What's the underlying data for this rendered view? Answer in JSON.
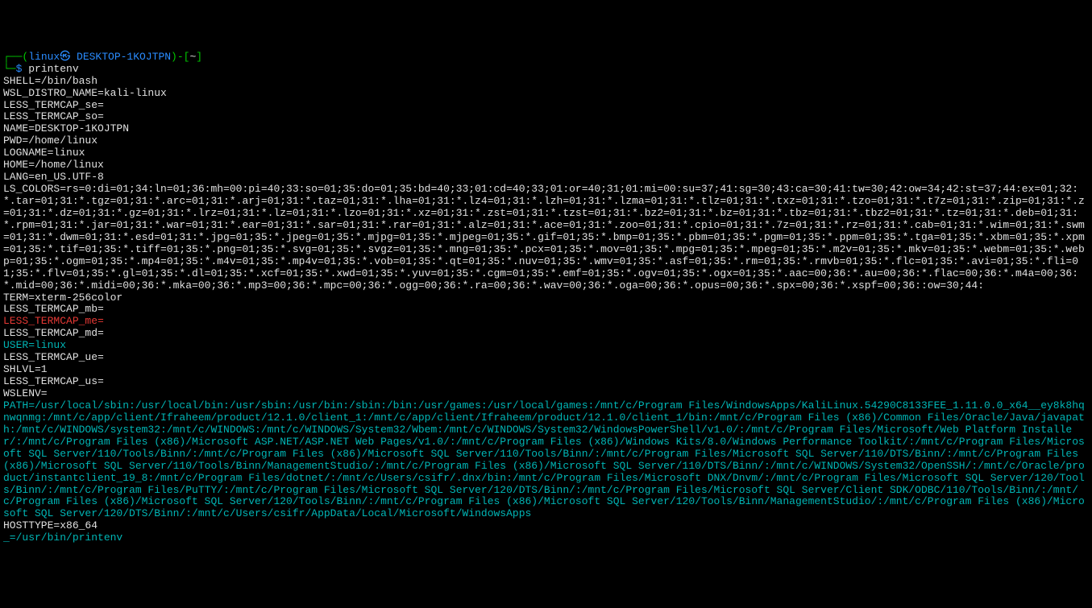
{
  "prompt": {
    "open": "┌──(",
    "user_host": "linux㉿ DESKTOP-1KOJTPN",
    "close_path_open": ")-[",
    "path": "~",
    "path_close": "]",
    "line2_prefix": "└─",
    "dollar": "$ ",
    "command": "printenv"
  },
  "env": {
    "SHELL": "SHELL=/bin/bash",
    "WSL_DISTRO_NAME": "WSL_DISTRO_NAME=kali-linux",
    "LESS_TERMCAP_se": "LESS_TERMCAP_se=",
    "LESS_TERMCAP_so": "LESS_TERMCAP_so=",
    "NAME": "NAME=DESKTOP-1KOJTPN",
    "PWD": "PWD=/home/linux",
    "LOGNAME": "LOGNAME=linux",
    "HOME": "HOME=/home/linux",
    "LANG": "LANG=en_US.UTF-8",
    "LS_COLORS": "LS_COLORS=rs=0:di=01;34:ln=01;36:mh=00:pi=40;33:so=01;35:do=01;35:bd=40;33;01:cd=40;33;01:or=40;31;01:mi=00:su=37;41:sg=30;43:ca=30;41:tw=30;42:ow=34;42:st=37;44:ex=01;32:*.tar=01;31:*.tgz=01;31:*.arc=01;31:*.arj=01;31:*.taz=01;31:*.lha=01;31:*.lz4=01;31:*.lzh=01;31:*.lzma=01;31:*.tlz=01;31:*.txz=01;31:*.tzo=01;31:*.t7z=01;31:*.zip=01;31:*.z=01;31:*.dz=01;31:*.gz=01;31:*.lrz=01;31:*.lz=01;31:*.lzo=01;31:*.xz=01;31:*.zst=01;31:*.tzst=01;31:*.bz2=01;31:*.bz=01;31:*.tbz=01;31:*.tbz2=01;31:*.tz=01;31:*.deb=01;31:*.rpm=01;31:*.jar=01;31:*.war=01;31:*.ear=01;31:*.sar=01;31:*.rar=01;31:*.alz=01;31:*.ace=01;31:*.zoo=01;31:*.cpio=01;31:*.7z=01;31:*.rz=01;31:*.cab=01;31:*.wim=01;31:*.swm=01;31:*.dwm=01;31:*.esd=01;31:*.jpg=01;35:*.jpeg=01;35:*.mjpg=01;35:*.mjpeg=01;35:*.gif=01;35:*.bmp=01;35:*.pbm=01;35:*.pgm=01;35:*.ppm=01;35:*.tga=01;35:*.xbm=01;35:*.xpm=01;35:*.tif=01;35:*.tiff=01;35:*.png=01;35:*.svg=01;35:*.svgz=01;35:*.mng=01;35:*.pcx=01;35:*.mov=01;35:*.mpg=01;35:*.mpeg=01;35:*.m2v=01;35:*.mkv=01;35:*.webm=01;35:*.webp=01;35:*.ogm=01;35:*.mp4=01;35:*.m4v=01;35:*.mp4v=01;35:*.vob=01;35:*.qt=01;35:*.nuv=01;35:*.wmv=01;35:*.asf=01;35:*.rm=01;35:*.rmvb=01;35:*.flc=01;35:*.avi=01;35:*.fli=01;35:*.flv=01;35:*.gl=01;35:*.dl=01;35:*.xcf=01;35:*.xwd=01;35:*.yuv=01;35:*.cgm=01;35:*.emf=01;35:*.ogv=01;35:*.ogx=01;35:*.aac=00;36:*.au=00;36:*.flac=00;36:*.m4a=00;36:*.mid=00;36:*.midi=00;36:*.mka=00;36:*.mp3=00;36:*.mpc=00;36:*.ogg=00;36:*.ra=00;36:*.wav=00;36:*.oga=00;36:*.opus=00;36:*.spx=00;36:*.xspf=00;36::ow=30;44:",
    "TERM": "TERM=xterm-256color",
    "LESS_TERMCAP_mb": "LESS_TERMCAP_mb=",
    "LESS_TERMCAP_me": "LESS_TERMCAP_me=",
    "LESS_TERMCAP_md": "LESS_TERMCAP_md=",
    "USER": "USER=linux",
    "LESS_TERMCAP_ue": "LESS_TERMCAP_ue=",
    "SHLVL": "SHLVL=1",
    "LESS_TERMCAP_us": "LESS_TERMCAP_us=",
    "WSLENV": "WSLENV=",
    "PATH": "PATH=/usr/local/sbin:/usr/local/bin:/usr/sbin:/usr/bin:/sbin:/bin:/usr/games:/usr/local/games:/mnt/c/Program Files/WindowsApps/KaliLinux.54290C8133FEE_1.11.0.0_x64__ey8k8hqnwqnmg:/mnt/c/app/client/Ifraheem/product/12.1.0/client_1:/mnt/c/app/client/Ifraheem/product/12.1.0/client_1/bin:/mnt/c/Program Files (x86)/Common Files/Oracle/Java/javapath:/mnt/c/WINDOWS/system32:/mnt/c/WINDOWS:/mnt/c/WINDOWS/System32/Wbem:/mnt/c/WINDOWS/System32/WindowsPowerShell/v1.0/:/mnt/c/Program Files/Microsoft/Web Platform Installer/:/mnt/c/Program Files (x86)/Microsoft ASP.NET/ASP.NET Web Pages/v1.0/:/mnt/c/Program Files (x86)/Windows Kits/8.0/Windows Performance Toolkit/:/mnt/c/Program Files/Microsoft SQL Server/110/Tools/Binn/:/mnt/c/Program Files (x86)/Microsoft SQL Server/110/Tools/Binn/:/mnt/c/Program Files/Microsoft SQL Server/110/DTS/Binn/:/mnt/c/Program Files (x86)/Microsoft SQL Server/110/Tools/Binn/ManagementStudio/:/mnt/c/Program Files (x86)/Microsoft SQL Server/110/DTS/Binn/:/mnt/c/WINDOWS/System32/OpenSSH/:/mnt/c/Oracle/product/instantclient_19_8:/mnt/c/Program Files/dotnet/:/mnt/c/Users/csifr/.dnx/bin:/mnt/c/Program Files/Microsoft DNX/Dnvm/:/mnt/c/Program Files/Microsoft SQL Server/120/Tools/Binn/:/mnt/c/Program Files/PuTTY/:/mnt/c/Program Files/Microsoft SQL Server/120/DTS/Binn/:/mnt/c/Program Files/Microsoft SQL Server/Client SDK/ODBC/110/Tools/Binn/:/mnt/c/Program Files (x86)/Microsoft SQL Server/120/Tools/Binn/:/mnt/c/Program Files (x86)/Microsoft SQL Server/120/Tools/Binn/ManagementStudio/:/mnt/c/Program Files (x86)/Microsoft SQL Server/120/DTS/Binn/:/mnt/c/Users/csifr/AppData/Local/Microsoft/WindowsApps",
    "HOSTTYPE": "HOSTTYPE=x86_64",
    "UNDERSCORE": "_=/usr/bin/printenv"
  }
}
